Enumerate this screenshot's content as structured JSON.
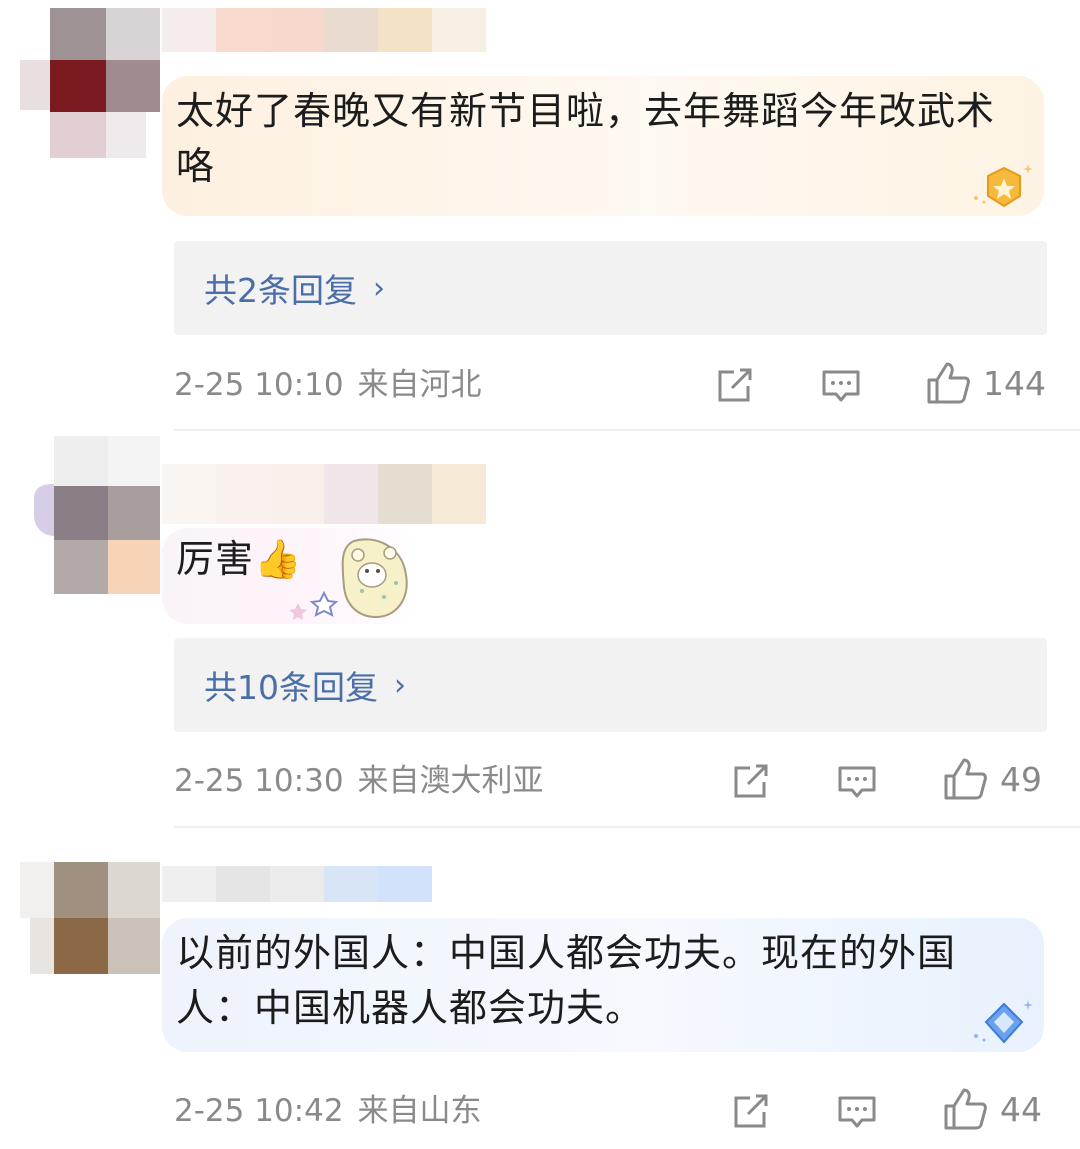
{
  "comments": [
    {
      "text": "太好了春晚又有新节目啦，去年舞蹈今年改武术咯",
      "replies_label": "共2条回复",
      "reply_chevron": "›",
      "date": "2-25 10:10",
      "location": "来自河北",
      "likes": "144",
      "bubble_theme": "gold",
      "badge_icon": "gold-star-badge-icon"
    },
    {
      "text": "厉害👍",
      "replies_label": "共10条回复",
      "reply_chevron": "›",
      "date": "2-25 10:30",
      "location": "来自澳大利亚",
      "likes": "49",
      "sticker_icon": "bear-sticker-icon"
    },
    {
      "text": "以前的外国人：中国人都会功夫。现在的外国人：中国机器人都会功夫。",
      "date": "2-25 10:42",
      "location": "来自山东",
      "likes": "44",
      "bubble_theme": "blue",
      "badge_icon": "blue-diamond-badge-icon"
    }
  ],
  "colors": {
    "reply_link": "#4a6ea8",
    "meta_text": "#8a8a8a",
    "reply_bg": "#f2f2f2",
    "gold_bubble": "#fdf3e2",
    "blue_bubble": "#eaf2fd"
  }
}
